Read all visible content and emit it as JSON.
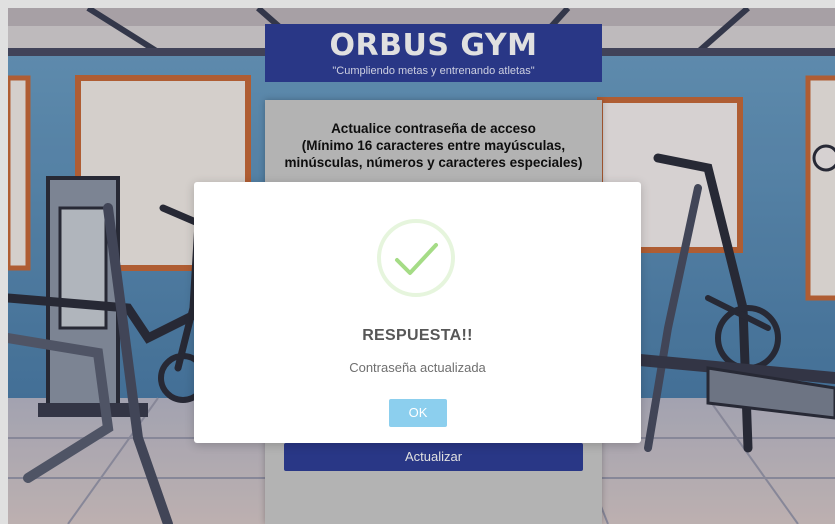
{
  "header": {
    "title": "ORBUS GYM",
    "slogan": "\"Cumpliendo metas y entrenando atletas\""
  },
  "panel": {
    "instructions": [
      "Actualice contraseña de acceso",
      "(Mínimo 16 caracteres entre mayúsculas,",
      "minúsculas, números y caracteres especiales)"
    ],
    "update_label": "Actualizar"
  },
  "modal": {
    "icon": "checkmark-icon",
    "heading": "RESPUESTA!!",
    "message": "Contraseña actualizada",
    "ok_label": "OK"
  },
  "colors": {
    "brand": "#2f3f99",
    "panel": "#cccccc",
    "success": "#a5dc86",
    "ok_button": "#8ccfee"
  }
}
